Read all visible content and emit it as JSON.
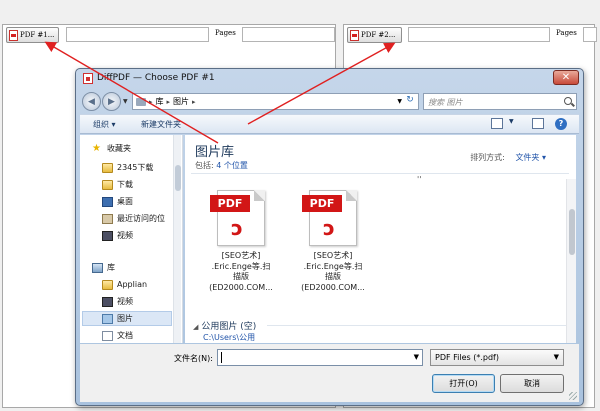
{
  "main": {
    "btn1_label": "PDF #1...",
    "btn2_label": "PDF #2...",
    "pages_label_1": "Pages",
    "pages_label_2": "Pages"
  },
  "dialog": {
    "title": "DiffPDF — Choose PDF #1",
    "address": {
      "crumb1": "库",
      "crumb2": "图片"
    },
    "search_placeholder": "搜索 图片",
    "toolbar": {
      "organize": "组织 ▾",
      "new_folder": "新建文件夹"
    },
    "sidebar": {
      "items": [
        {
          "label": "收藏夹",
          "icon": "star-icon"
        },
        {
          "label": "2345下载",
          "icon": "folder-icon"
        },
        {
          "label": "下载",
          "icon": "folder-icon"
        },
        {
          "label": "桌面",
          "icon": "desktop-icon"
        },
        {
          "label": "最近访问的位",
          "icon": "recent-places-icon"
        },
        {
          "label": "视频",
          "icon": "video-icon"
        },
        {
          "label": "库",
          "icon": "library-icon"
        },
        {
          "label": "Applian",
          "icon": "folder-icon"
        },
        {
          "label": "视频",
          "icon": "video-icon"
        },
        {
          "label": "图片",
          "icon": "pictures-icon"
        },
        {
          "label": "文档",
          "icon": "documents-icon"
        },
        {
          "label": "",
          "icon": "music-icon"
        }
      ]
    },
    "library": {
      "title": "图片库",
      "includes_prefix": "包括:",
      "includes_link": "4 个位置",
      "arrange_label": "排列方式:",
      "arrange_value": "文件夹 ▾",
      "marker": "''"
    },
    "files": [
      {
        "band": "PDF",
        "name_line1": "[SEO艺术]",
        "name_line2": ".Eric.Enge等.扫",
        "name_line3": "描版",
        "name_line4": "(ED2000.COM..."
      },
      {
        "band": "PDF",
        "name_line1": "[SEO艺术]",
        "name_line2": ".Eric.Enge等.扫",
        "name_line3": "描版",
        "name_line4": "(ED2000.COM..."
      }
    ],
    "group": {
      "title": "公用图片 (空)",
      "path": "C:\\Users\\公用"
    },
    "filename_label": "文件名(N):",
    "filename_value": "",
    "filetype_value": "PDF Files (*.pdf)",
    "open_button": "打开(O)",
    "cancel_button": "取消"
  },
  "colors": {
    "annotation_arrow": "#e02020",
    "pdf_red": "#d21616",
    "link_blue": "#2255aa"
  }
}
